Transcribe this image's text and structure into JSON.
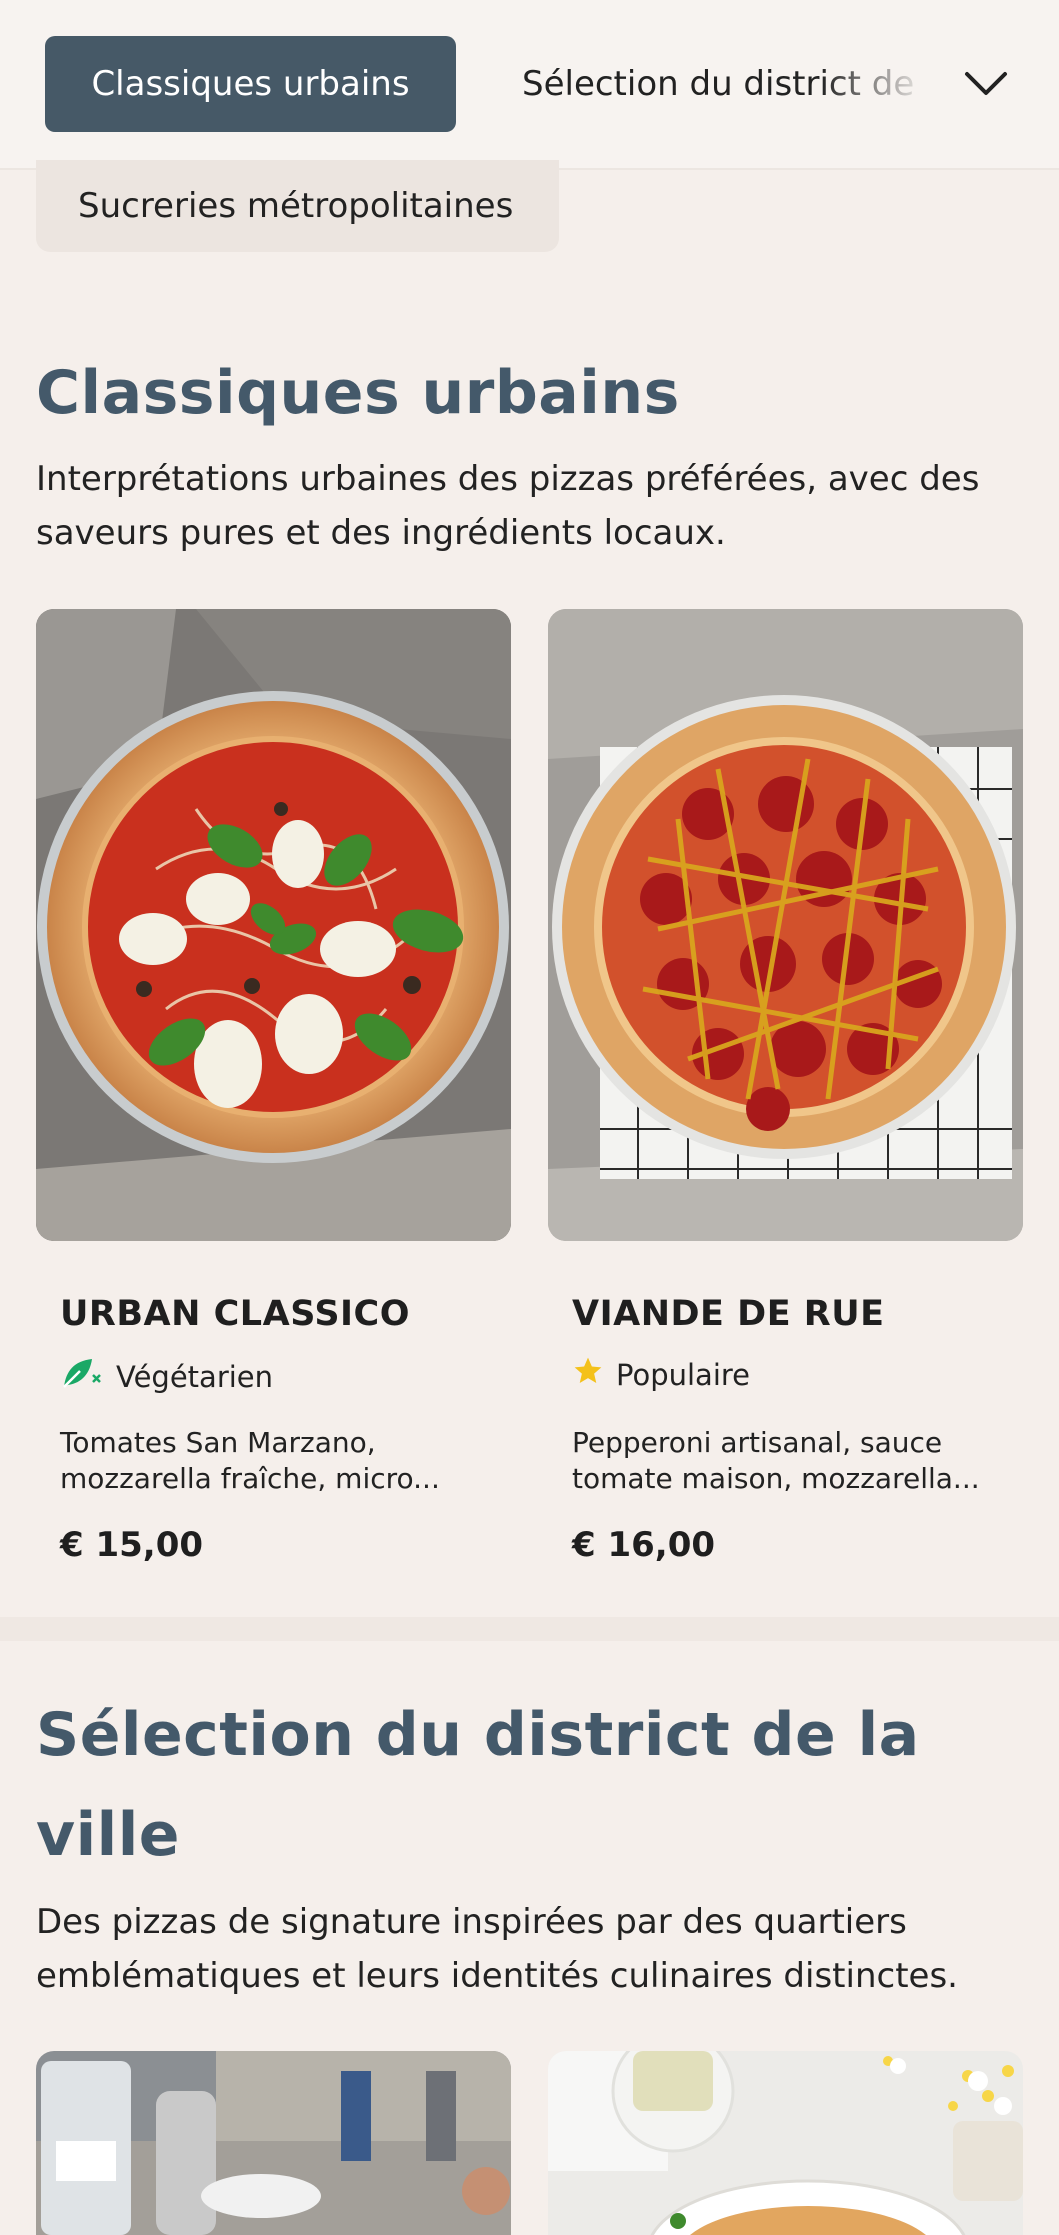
{
  "nav": {
    "active_tab": "Classiques urbains",
    "tabs": [
      "Sélection du district de la ville",
      "Sucreries métropolitaines"
    ]
  },
  "sections": [
    {
      "title": "Classiques urbains",
      "description": "Interprétations urbaines des pizzas préférées, avec des saveurs pures et des ingrédients locaux.",
      "items": [
        {
          "name": "URBAN CLASSICO",
          "badge": "Végétarien",
          "badge_icon": "leaf-vegetarian-icon",
          "description_line1": "Tomates San Marzano,",
          "description_line2": "mozzarella fraîche, micro...",
          "price": "€ 15,00"
        },
        {
          "name": "VIANDE DE RUE",
          "badge": "Populaire",
          "badge_icon": "star-icon",
          "description_line1": "Pepperoni artisanal, sauce",
          "description_line2": "tomate maison, mozzarella...",
          "price": "€ 16,00"
        }
      ]
    },
    {
      "title_line1": "Sélection du district de la",
      "title_line2": "ville",
      "description": "Des pizzas de signature inspirées par des quartiers emblématiques et leurs identités culinaires distinctes."
    }
  ],
  "colors": {
    "accent": "#465967",
    "title": "#44596a",
    "background": "#f5efeb",
    "vegetarian": "#1aa866",
    "star": "#f4c11a"
  }
}
